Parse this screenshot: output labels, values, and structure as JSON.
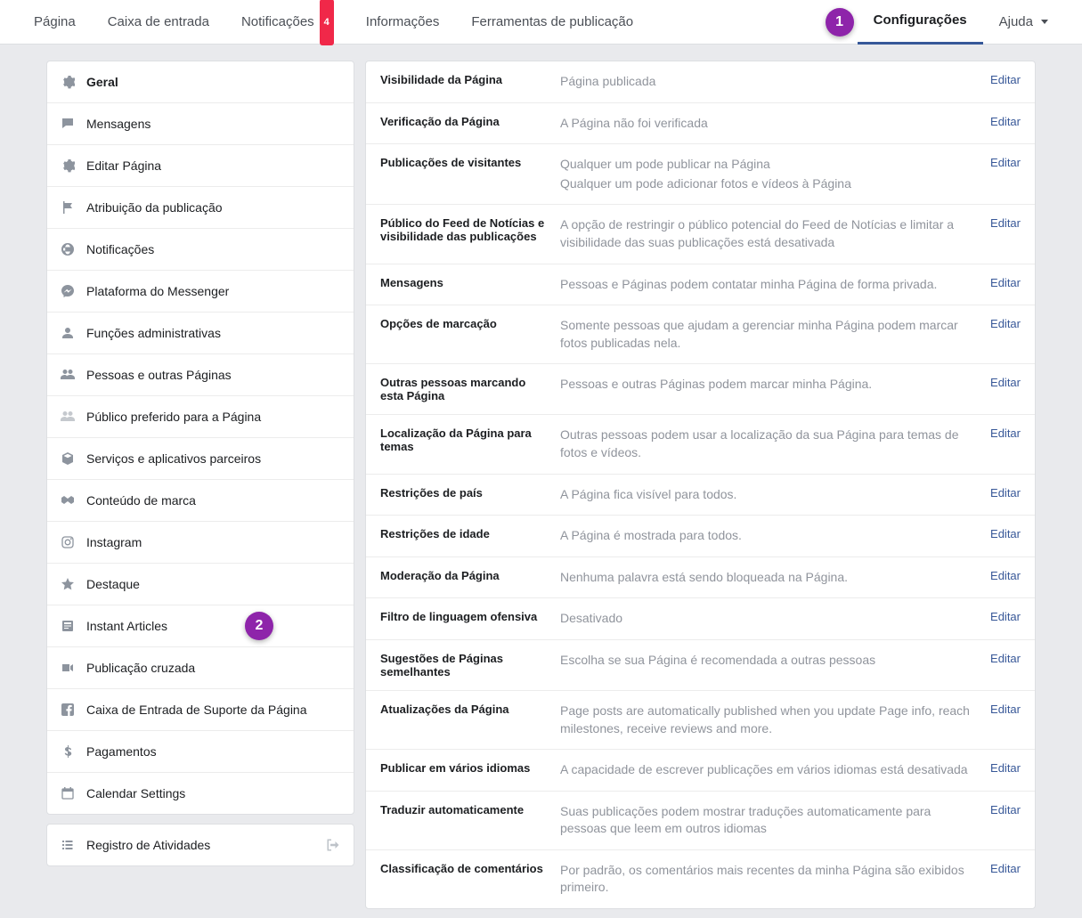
{
  "annotations": {
    "a1": "1",
    "a2": "2"
  },
  "topnav": {
    "items": [
      {
        "label": "Página"
      },
      {
        "label": "Caixa de entrada"
      },
      {
        "label": "Notificações",
        "badge": "4"
      },
      {
        "label": "Informações"
      },
      {
        "label": "Ferramentas de publicação"
      },
      {
        "label": "Configurações",
        "active": true
      },
      {
        "label": "Ajuda",
        "dropdown": true
      }
    ]
  },
  "sidebar": {
    "items": [
      {
        "label": "Geral",
        "icon": "gear",
        "active": true
      },
      {
        "label": "Mensagens",
        "icon": "chat"
      },
      {
        "label": "Editar Página",
        "icon": "gear"
      },
      {
        "label": "Atribuição da publicação",
        "icon": "flag"
      },
      {
        "label": "Notificações",
        "icon": "globe"
      },
      {
        "label": "Plataforma do Messenger",
        "icon": "messenger"
      },
      {
        "label": "Funções administrativas",
        "icon": "person"
      },
      {
        "label": "Pessoas e outras Páginas",
        "icon": "people"
      },
      {
        "label": "Público preferido para a Página",
        "icon": "people-light"
      },
      {
        "label": "Serviços e aplicativos parceiros",
        "icon": "cube"
      },
      {
        "label": "Conteúdo de marca",
        "icon": "handshake"
      },
      {
        "label": "Instagram",
        "icon": "instagram"
      },
      {
        "label": "Destaque",
        "icon": "star"
      },
      {
        "label": "Instant Articles",
        "icon": "article"
      },
      {
        "label": "Publicação cruzada",
        "icon": "video"
      },
      {
        "label": "Caixa de Entrada de Suporte da Página",
        "icon": "fb"
      },
      {
        "label": "Pagamentos",
        "icon": "dollar"
      },
      {
        "label": "Calendar Settings",
        "icon": "calendar"
      }
    ],
    "activity": {
      "label": "Registro de Atividades",
      "icon": "list"
    }
  },
  "settings": {
    "edit_label": "Editar",
    "rows": [
      {
        "label": "Visibilidade da Página",
        "value": [
          "Página publicada"
        ]
      },
      {
        "label": "Verificação da Página",
        "value": [
          "A Página não foi verificada"
        ]
      },
      {
        "label": "Publicações de visitantes",
        "value": [
          "Qualquer um pode publicar na Página",
          "Qualquer um pode adicionar fotos e vídeos à Página"
        ]
      },
      {
        "label": "Público do Feed de Notícias e visibilidade das publicações",
        "value": [
          "A opção de restringir o público potencial do Feed de Notícias e limitar a visibilidade das suas publicações está desativada"
        ]
      },
      {
        "label": "Mensagens",
        "value": [
          "Pessoas e Páginas podem contatar minha Página de forma privada."
        ]
      },
      {
        "label": "Opções de marcação",
        "value": [
          "Somente pessoas que ajudam a gerenciar minha Página podem marcar fotos publicadas nela."
        ]
      },
      {
        "label": "Outras pessoas marcando esta Página",
        "value": [
          "Pessoas e outras Páginas podem marcar minha Página."
        ]
      },
      {
        "label": "Localização da Página para temas",
        "value": [
          "Outras pessoas podem usar a localização da sua Página para temas de fotos e vídeos."
        ]
      },
      {
        "label": "Restrições de país",
        "value": [
          "A Página fica visível para todos."
        ]
      },
      {
        "label": "Restrições de idade",
        "value": [
          "A Página é mostrada para todos."
        ]
      },
      {
        "label": "Moderação da Página",
        "value": [
          "Nenhuma palavra está sendo bloqueada na Página."
        ]
      },
      {
        "label": "Filtro de linguagem ofensiva",
        "value": [
          "Desativado"
        ]
      },
      {
        "label": "Sugestões de Páginas semelhantes",
        "value": [
          "Escolha se sua Página é recomendada a outras pessoas"
        ]
      },
      {
        "label": "Atualizações da Página",
        "value": [
          "Page posts are automatically published when you update Page info, reach milestones, receive reviews and more."
        ]
      },
      {
        "label": "Publicar em vários idiomas",
        "value": [
          "A capacidade de escrever publicações em vários idiomas está desativada"
        ]
      },
      {
        "label": "Traduzir automaticamente",
        "value": [
          "Suas publicações podem mostrar traduções automaticamente para pessoas que leem em outros idiomas"
        ]
      },
      {
        "label": "Classificação de comentários",
        "value": [
          "Por padrão, os comentários mais recentes da minha Página são exibidos primeiro."
        ]
      }
    ]
  }
}
